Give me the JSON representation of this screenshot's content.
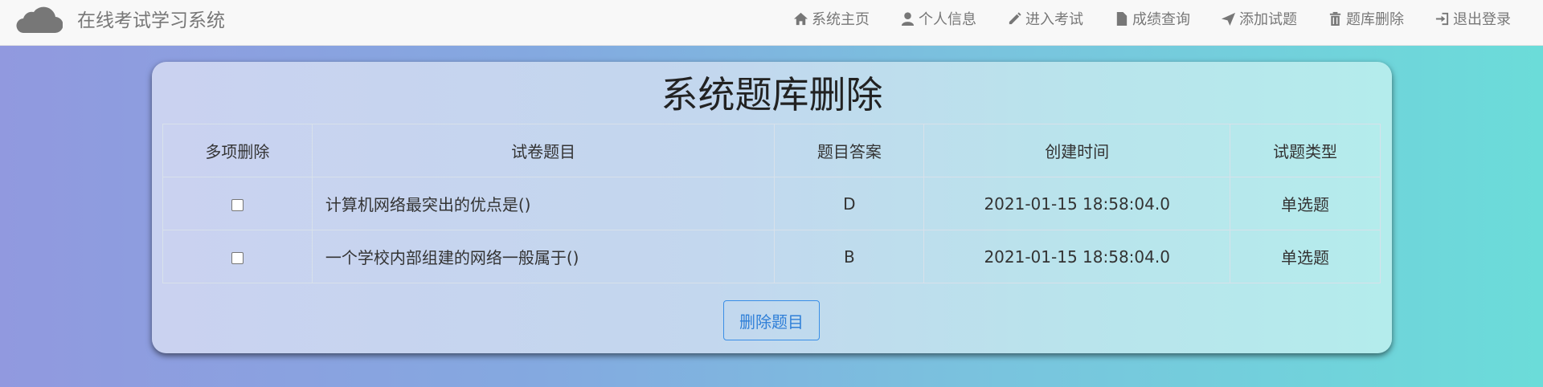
{
  "app": {
    "title": "在线考试学习系统",
    "logo_icon": "cloud-icon"
  },
  "nav": [
    {
      "label": "系统主页",
      "icon": "home-icon"
    },
    {
      "label": "个人信息",
      "icon": "user-icon"
    },
    {
      "label": "进入考试",
      "icon": "pencil-icon"
    },
    {
      "label": "成绩查询",
      "icon": "file-icon"
    },
    {
      "label": "添加试题",
      "icon": "send-icon"
    },
    {
      "label": "题库删除",
      "icon": "trash-icon"
    },
    {
      "label": "退出登录",
      "icon": "logout-icon"
    }
  ],
  "page": {
    "title": "系统题库删除"
  },
  "table": {
    "headers": [
      "多项删除",
      "试卷题目",
      "题目答案",
      "创建时间",
      "试题类型"
    ],
    "rows": [
      {
        "checked": false,
        "question": "计算机网络最突出的优点是()",
        "answer": "D",
        "created": "2021-01-15 18:58:04.0",
        "type": "单选题"
      },
      {
        "checked": false,
        "question": "一个学校内部组建的网络一般属于()",
        "answer": "B",
        "created": "2021-01-15 18:58:04.0",
        "type": "单选题"
      }
    ]
  },
  "actions": {
    "delete_label": "删除题目"
  },
  "colors": {
    "accent": "#2f7fd8",
    "navbar_bg": "#f8f8f8",
    "nav_text": "#777777"
  }
}
